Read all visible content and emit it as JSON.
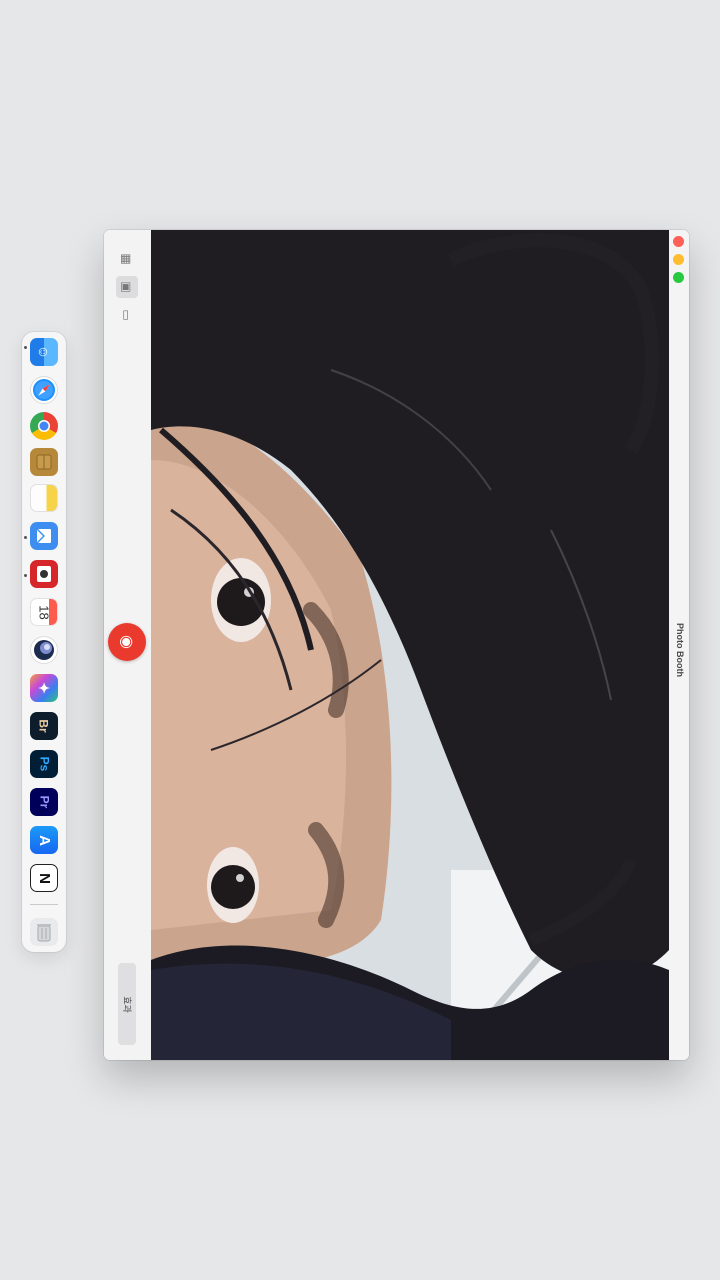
{
  "window": {
    "title": "Photo Booth"
  },
  "toolbar": {
    "view_buttons": [
      "grid-view",
      "single-photo-view",
      "video-view"
    ],
    "shutter_icon": "camera-icon",
    "effects_label": "효과"
  },
  "dock": {
    "apps": [
      {
        "name": "Finder",
        "icon": "finder-icon"
      },
      {
        "name": "Safari",
        "icon": "safari-icon"
      },
      {
        "name": "Google Chrome",
        "icon": "chrome-icon"
      },
      {
        "name": "App",
        "icon": "box-icon"
      },
      {
        "name": "Notes",
        "icon": "notes-icon"
      },
      {
        "name": "Mail",
        "icon": "mail-icon"
      },
      {
        "name": "Photo Booth",
        "icon": "photo-booth-icon"
      },
      {
        "name": "Calendar",
        "icon": "calendar-icon",
        "label": "18"
      },
      {
        "name": "Cinema 4D",
        "icon": "cinema4d-icon"
      },
      {
        "name": "Final Cut Pro",
        "icon": "final-cut-icon"
      },
      {
        "name": "Adobe Bridge",
        "icon": "bridge-icon",
        "label": "Br"
      },
      {
        "name": "Adobe Photoshop",
        "icon": "photoshop-icon",
        "label": "Ps"
      },
      {
        "name": "Adobe Premiere Pro",
        "icon": "premiere-icon",
        "label": "Pr"
      },
      {
        "name": "App Store",
        "icon": "app-store-icon"
      },
      {
        "name": "Notion",
        "icon": "notion-icon",
        "label": "N"
      },
      {
        "name": "Trash",
        "icon": "trash-icon"
      }
    ]
  }
}
